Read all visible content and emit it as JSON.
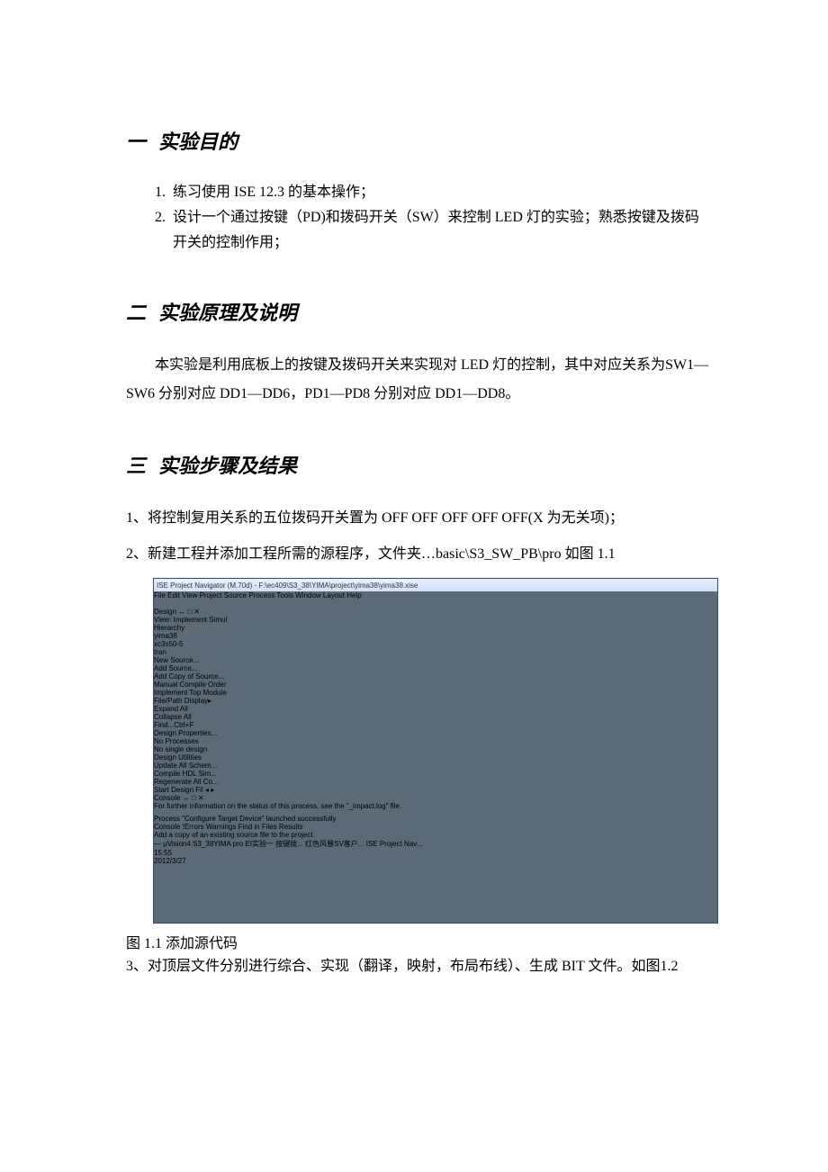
{
  "section1": {
    "counter": "一",
    "title": "实验目的",
    "items": [
      "练习使用 ISE 12.3 的基本操作；",
      "设计一个通过按键（PD)和拨码开关（SW）来控制 LED 灯的实验；熟悉按键及拨码开关的控制作用；"
    ]
  },
  "section2": {
    "counter": "二",
    "title": "实验原理及说明",
    "body": "本实验是利用底板上的按键及拨码开关来实现对 LED 灯的控制，其中对应关系为SW1—SW6 分别对应 DD1—DD6，PD1—PD8 分别对应 DD1—DD8。"
  },
  "section3": {
    "counter": "三",
    "title": "实验步骤及结果",
    "step1": "1、将控制复用关系的五位拨码开关置为 OFF OFF OFF OFF OFF(X 为无关项)；",
    "step2": "2、新建工程并添加工程所需的源程序，文件夹…basic\\S3_SW_PB\\pro 如图 1.1",
    "step3": "3、对顶层文件分别进行综合、实现（翻译，映射，布局布线）、生成 BIT 文件。如图1.2"
  },
  "screenshot": {
    "titlebar": "ISE Project Navigator (M.70d) - F:\\ec409\\S3_38\\YIMA\\project\\yima38\\yima38.xise",
    "menubar": [
      "File",
      "Edit",
      "View",
      "Project",
      "Source",
      "Process",
      "Tools",
      "Window",
      "Layout",
      "Help"
    ],
    "design_panel": {
      "header": "Design",
      "pin_label": "↔ □ ✕",
      "view_radio_impl": "Implement",
      "view_radio_sim": "Simul",
      "view_label": "View:",
      "hierarchy_label": "Hierarchy",
      "project_name": "yima38",
      "device_name": "xc3s50-5",
      "module_name": "tran",
      "no_proc": "No Processes",
      "no_single": "No single design",
      "design_utils": "Design Utilities",
      "util1": "Update All Schem...",
      "util2": "Compile HDL Sim...",
      "util3": "Regenerate All Co..."
    },
    "context_menu": {
      "new_source": "New Source...",
      "add_source": "Add Source...",
      "add_copy": "Add Copy of Source...",
      "manual_compile": "Manual Compile Order",
      "implement_top": "Implement Top Module",
      "file_path": "File/Path Display",
      "expand_all": "Expand All",
      "collapse_all": "Collapse All",
      "find": "Find...",
      "find_shortcut": "Ctrl+F",
      "design_props": "Design Properties..."
    },
    "bottom_tabs": {
      "start": "Start",
      "design": "Design",
      "fil": "Fil"
    },
    "console": {
      "header": "Console",
      "pin_label": "↔ □ ✕",
      "line1": "For further information on the status of this process, see the \"_impact.log\" file.",
      "line2": "Process \"Configure Target Device\" launched successfully",
      "tab_console": "Console",
      "tab_errors": "Errors",
      "tab_warnings": "Warnings",
      "tab_find": "Find in Files Results"
    },
    "statusline": "Add a copy of an existing source file to the project",
    "taskbar": {
      "items": [
        "— μVision4",
        "",
        "S3_38YIMA",
        "pro",
        "EI实验一 按键拨...",
        "红色风暴SV客户...",
        "ISE Project Nav..."
      ],
      "clock_time": "15:55",
      "clock_date": "2012/3/27"
    }
  },
  "caption1": "图 1.1  添加源代码"
}
